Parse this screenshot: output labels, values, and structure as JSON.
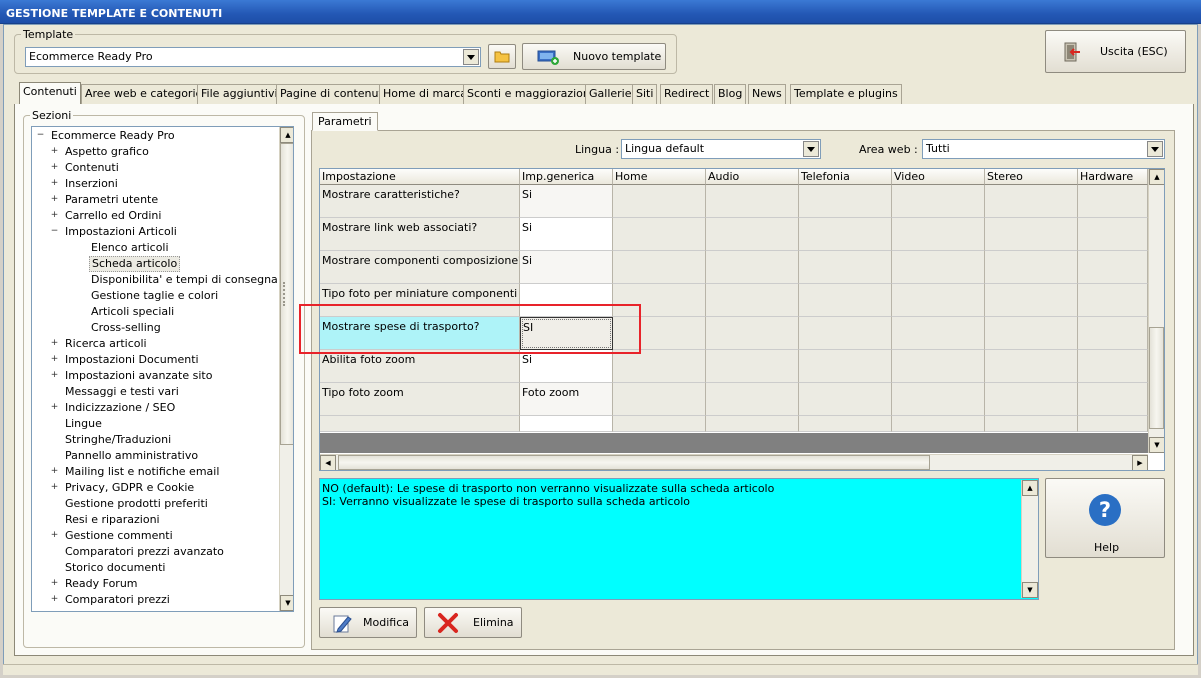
{
  "window": {
    "title": "GESTIONE TEMPLATE E CONTENUTI"
  },
  "template_group": {
    "label": "Template",
    "selected": "Ecommerce Ready Pro",
    "new_button": "Nuovo template"
  },
  "exit_button": "Uscita (ESC)",
  "tabs": [
    {
      "label": "Contenuti"
    },
    {
      "label": "Aree web e categorie"
    },
    {
      "label": "File aggiuntivi"
    },
    {
      "label": "Pagine di contenuti"
    },
    {
      "label": "Home di marca"
    },
    {
      "label": "Sconti e maggiorazioni"
    },
    {
      "label": "Gallerie"
    },
    {
      "label": "Siti"
    },
    {
      "label": "Redirect"
    },
    {
      "label": "Blog"
    },
    {
      "label": "News"
    },
    {
      "label": "Template e plugins"
    }
  ],
  "sections": {
    "label": "Sezioni",
    "tree": [
      {
        "label": "Ecommerce Ready Pro",
        "level": 0,
        "expander": "minus"
      },
      {
        "label": "Aspetto grafico",
        "level": 1,
        "expander": "plus"
      },
      {
        "label": "Contenuti",
        "level": 1,
        "expander": "plus"
      },
      {
        "label": "Inserzioni",
        "level": 1,
        "expander": "plus"
      },
      {
        "label": "Parametri utente",
        "level": 1,
        "expander": "plus"
      },
      {
        "label": "Carrello ed Ordini",
        "level": 1,
        "expander": "plus"
      },
      {
        "label": "Impostazioni Articoli",
        "level": 1,
        "expander": "minus"
      },
      {
        "label": "Elenco articoli",
        "level": 2,
        "expander": ""
      },
      {
        "label": "Scheda articolo",
        "level": 2,
        "expander": "",
        "selected": true
      },
      {
        "label": "Disponibilita' e tempi di consegna",
        "level": 2,
        "expander": ""
      },
      {
        "label": "Gestione taglie e colori",
        "level": 2,
        "expander": ""
      },
      {
        "label": "Articoli speciali",
        "level": 2,
        "expander": ""
      },
      {
        "label": "Cross-selling",
        "level": 2,
        "expander": ""
      },
      {
        "label": "Ricerca articoli",
        "level": 1,
        "expander": "plus"
      },
      {
        "label": "Impostazioni Documenti",
        "level": 1,
        "expander": "plus"
      },
      {
        "label": "Impostazioni avanzate sito",
        "level": 1,
        "expander": "plus"
      },
      {
        "label": "Messaggi e testi vari",
        "level": 1,
        "expander": ""
      },
      {
        "label": "Indicizzazione / SEO",
        "level": 1,
        "expander": "plus"
      },
      {
        "label": "Lingue",
        "level": 1,
        "expander": ""
      },
      {
        "label": "Stringhe/Traduzioni",
        "level": 1,
        "expander": ""
      },
      {
        "label": "Pannello amministrativo",
        "level": 1,
        "expander": ""
      },
      {
        "label": "Mailing list e notifiche email",
        "level": 1,
        "expander": "plus"
      },
      {
        "label": "Privacy, GDPR e Cookie",
        "level": 1,
        "expander": "plus"
      },
      {
        "label": "Gestione prodotti preferiti",
        "level": 1,
        "expander": ""
      },
      {
        "label": "Resi e riparazioni",
        "level": 1,
        "expander": ""
      },
      {
        "label": "Gestione commenti",
        "level": 1,
        "expander": "plus"
      },
      {
        "label": "Comparatori prezzi avanzato",
        "level": 1,
        "expander": ""
      },
      {
        "label": "Storico documenti",
        "level": 1,
        "expander": ""
      },
      {
        "label": "Ready Forum",
        "level": 1,
        "expander": "plus"
      },
      {
        "label": "Comparatori prezzi",
        "level": 1,
        "expander": "plus"
      }
    ]
  },
  "params": {
    "tab": "Parametri",
    "lingua_label": "Lingua :",
    "lingua_value": "Lingua default",
    "area_label": "Area web :",
    "area_value": "Tutti",
    "columns": [
      "Impostazione",
      "Imp.generica",
      "Home",
      "Audio",
      "Telefonia",
      "Video",
      "Stereo",
      "Hardware"
    ],
    "rows": [
      {
        "setting": "Mostrare caratteristiche?",
        "value": "Si"
      },
      {
        "setting": "Mostrare link web associati?",
        "value": "Si"
      },
      {
        "setting": "Mostrare componenti composizione?",
        "value": "Si"
      },
      {
        "setting": "Tipo foto per miniature componenti",
        "value": ""
      },
      {
        "setting": "Mostrare spese di trasporto?",
        "value": "SI",
        "selected": true
      },
      {
        "setting": "Abilita foto zoom",
        "value": "Si"
      },
      {
        "setting": "Tipo foto zoom",
        "value": "Foto zoom"
      },
      {
        "setting": "",
        "value": ""
      }
    ],
    "help_lines": [
      "NO (default): Le spese di trasporto non verranno visualizzate sulla scheda articolo",
      "SI: Verranno visualizzate le spese di trasporto sulla scheda articolo"
    ],
    "help_button": "Help",
    "modify_button": "Modifica",
    "delete_button": "Elimina"
  },
  "colors": {
    "selection": "#aef3f8",
    "help_bg": "#00ffff",
    "highlight_box": "#e8232a"
  }
}
